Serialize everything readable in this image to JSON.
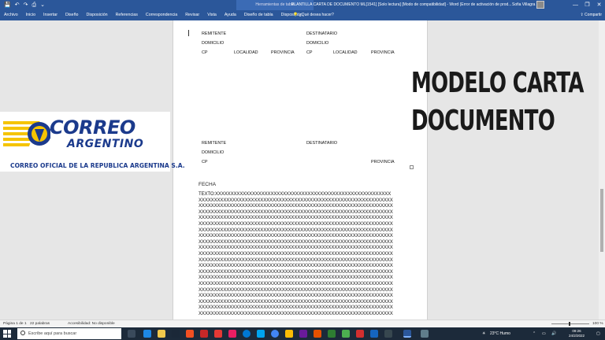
{
  "titlebar": {
    "context_tab": "Herramientas de tabla",
    "document_title": "PLANTILLA CARTA DE DOCUMENTO ML[1541] [Solo lectura] [Modo de compatibilidad] - Word (Error de activación de prod...",
    "user_name": "Sofia Villagra",
    "quick_access": [
      "💾",
      "↶",
      "↷",
      "⎙",
      "⌄"
    ],
    "window_controls": [
      "—",
      "❐",
      "✕"
    ]
  },
  "ribbon": {
    "tabs": [
      "Archivo",
      "Inicio",
      "Insertar",
      "Diseño",
      "Disposición",
      "Referencias",
      "Correspondencia",
      "Revisar",
      "Vista",
      "Ayuda",
      "Diseño de tabla",
      "Disposición"
    ],
    "tell_me": "¿Qué desea hacer?",
    "share": "Compartir"
  },
  "document": {
    "block1": {
      "remitente": "REMITENTE",
      "domicilio": "DOMICILIO",
      "cp": "CP",
      "localidad": "LOCALIDAD",
      "provincia": "PROVINCIA",
      "destinatario": "DESTINATARIO",
      "domicilio2": "DOMICILIO",
      "cp2": "CP",
      "localidad2": "LOCALIDAD",
      "provincia2": "PROVINCIA"
    },
    "block2": {
      "remitente": "REMITENTE",
      "domicilio": "DOMICILIO",
      "cp": "CP",
      "destinatario": "DESTINATARIO",
      "provincia": "PROVINCIA"
    },
    "fecha": "FECHA",
    "texto_label": "TEXTO:",
    "texto_first": "XXXXXXXXXXXXXXXXXXXXXXXXXXXXXXXXXXXXXXXXXXXXXXXXXXXXXXXXX",
    "texto_line": "XXXXXXXXXXXXXXXXXXXXXXXXXXXXXXXXXXXXXXXXXXXXXXXXXXXXXXXXXXXXXXX"
  },
  "overlay": {
    "line1": "MODELO CARTA",
    "line2": "DOCUMENTO"
  },
  "logo": {
    "word1": "CORREO",
    "word2": "ARGENTINO",
    "tagline": "CORREO OFICIAL DE LA REPUBLICA ARGENTINA S.A.",
    "colors": {
      "blue": "#1b3a8c",
      "yellow": "#f5c400"
    }
  },
  "statusbar": {
    "page": "Página 1 de 1",
    "words": "22 palabras",
    "accessibility": "Accesibilidad: No disponible",
    "zoom": "100 %"
  },
  "taskbar": {
    "search_placeholder": "Escribe aquí para buscar",
    "weather": "23°C  Humo",
    "time": "09:26",
    "date": "24/2/2022"
  },
  "accent": "#2b579a"
}
